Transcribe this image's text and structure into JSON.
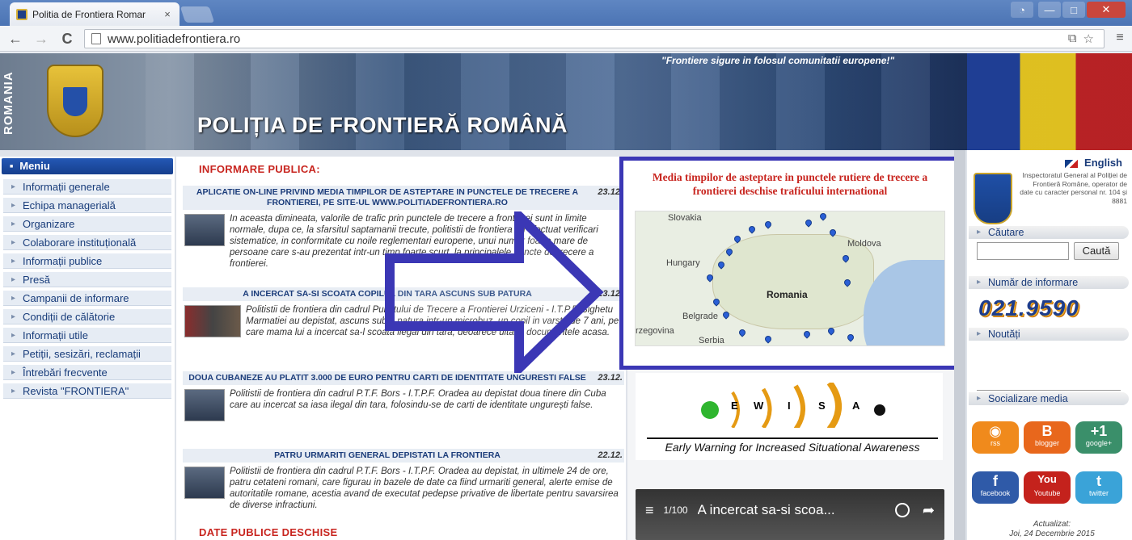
{
  "browser": {
    "tab_title": "Politia de Frontiera Romar",
    "tab_close": "×",
    "url": "www.politiadefrontiera.ro",
    "back": "←",
    "forward": "→",
    "reload": "C",
    "translate_icon": "⧉",
    "bookmark_icon": "☆",
    "menu_icon": "≡",
    "window_min": "—",
    "window_max": "□",
    "window_close": "✕",
    "user_icon": "◔"
  },
  "banner": {
    "vertical_text": "ROMANIA",
    "motto": "\"Frontiere sigure in folosul comunitatii europene!\"",
    "site_title": "POLIȚIA DE FRONTIERĂ ROMÂNĂ"
  },
  "left_menu": {
    "header": "Meniu",
    "items": [
      "Informații generale",
      "Echipa managerială",
      "Organizare",
      "Colaborare instituțională",
      "Informații publice",
      "Presă",
      "Campanii de informare",
      "Condiții de călătorie",
      "Informații utile",
      "Petiții, sesizări, reclamații",
      "Întrebări frecvente",
      "Revista \"FRONTIERA\""
    ]
  },
  "center": {
    "section_title": "INFORMARE PUBLICA:",
    "bottom_section_title": "DATE PUBLICE DESCHISE",
    "news": [
      {
        "title": "APLICATIE ON-LINE PRIVIND MEDIA TIMPILOR DE ASTEPTARE IN PUNCTELE DE TRECERE A FRONTIEREI, PE SITE-UL WWW.POLITIADEFRONTIERA.RO",
        "date": "23.12.",
        "body": "In aceasta dimineata, valorile de trafic prin punctele de trecere a frontierei sunt in limite normale, dupa ce, la sfarsitul saptamanii trecute, politistii de frontiera au efectuat verificari sistematice, in conformitate cu noile reglementari europene, unui numar foarte mare de persoane care s-au prezentat intr-un timp foarte scurt, la principalele puncte de trecere a frontierei."
      },
      {
        "title": "A INCERCAT SA-SI SCOATA COPILUL DIN TARA ASCUNS SUB PATURA",
        "date": "23.12.",
        "body": "Politistii de frontiera din cadrul Punctului de Trecere a Frontierei Urziceni - I.T.P.F. Sighetu Marmatiei au depistat, ascuns sub o patura intr-un microbuz, un copil in varsta de 7 ani, pe care mama lui a incercat sa-l scoata ilegal din tara, deoarece uitase documentele acasa."
      },
      {
        "title": "DOUA CUBANEZE AU PLATIT 3.000 DE EURO PENTRU CARTI DE IDENTITATE UNGURESTI FALSE",
        "date": "23.12.",
        "body": "Politistii de frontiera din cadrul P.T.F. Bors - I.T.P.F. Oradea au depistat doua tinere din Cuba care au incercat sa iasa ilegal din tara, folosindu-se de carti de identitate ungurești false."
      },
      {
        "title": "PATRU URMARITI GENERAL DEPISTATI LA FRONTIERA",
        "date": "22.12.",
        "body": "Politistii de frontiera din cadrul P.T.F. Bors - I.T.P.F. Oradea au depistat, in ultimele 24 de ore, patru cetateni romani, care figurau in bazele de date ca fiind urmariti general, alerte emise de autoritatile romane, acestia avand de executat pedepse privative de libertate pentru savarsirea de diverse infractiuni."
      }
    ]
  },
  "map_box": {
    "title": "Media timpilor de asteptare in punctele rutiere de trecere a frontierei deschise traficului international",
    "labels": {
      "slovakia": "Slovakia",
      "hungary": "Hungary",
      "romania": "Romania",
      "moldova": "Moldova",
      "bosnia": "rzegovina",
      "serbia": "Serbia",
      "belgrade": "Belgrade"
    },
    "accent_color": "#3b37b5"
  },
  "ewisa": {
    "letters": [
      "E",
      "W",
      "I",
      "S",
      "A"
    ],
    "caption": "Early Warning for Increased Situational Awareness"
  },
  "video": {
    "menu_icon": "≡",
    "count": "1/100",
    "title": "A incercat sa-si scoa...",
    "share_icon": "➦"
  },
  "sidebar": {
    "language": "English",
    "igpf_text": "Inspectoratul General al Poliției de Frontieră Române, operator de date cu caracter personal nr. 104 și 8881",
    "search_header": "Căutare",
    "search_button": "Caută",
    "info_header": "Număr de informare",
    "info_phone": "021.9590",
    "news_header": "Noutăți",
    "social_header": "Socializare media",
    "social": [
      {
        "name": "rss",
        "label": "rss",
        "glyph": "◉",
        "color": "#f08a1c"
      },
      {
        "name": "blogger",
        "label": "blogger",
        "glyph": "B",
        "color": "#e8671c"
      },
      {
        "name": "googleplus",
        "label": "google+",
        "glyph": "+1",
        "color": "#3a8f6a"
      },
      {
        "name": "facebook",
        "label": "facebook",
        "glyph": "f",
        "color": "#2f5aa8"
      },
      {
        "name": "youtube",
        "label": "Youtube",
        "glyph": "You",
        "color": "#c4221c"
      },
      {
        "name": "twitter",
        "label": "twitter",
        "glyph": "t",
        "color": "#3aa3d8"
      }
    ],
    "updated_label": "Actualizat:",
    "updated_date": "Joi, 24 Decembrie 2015"
  }
}
